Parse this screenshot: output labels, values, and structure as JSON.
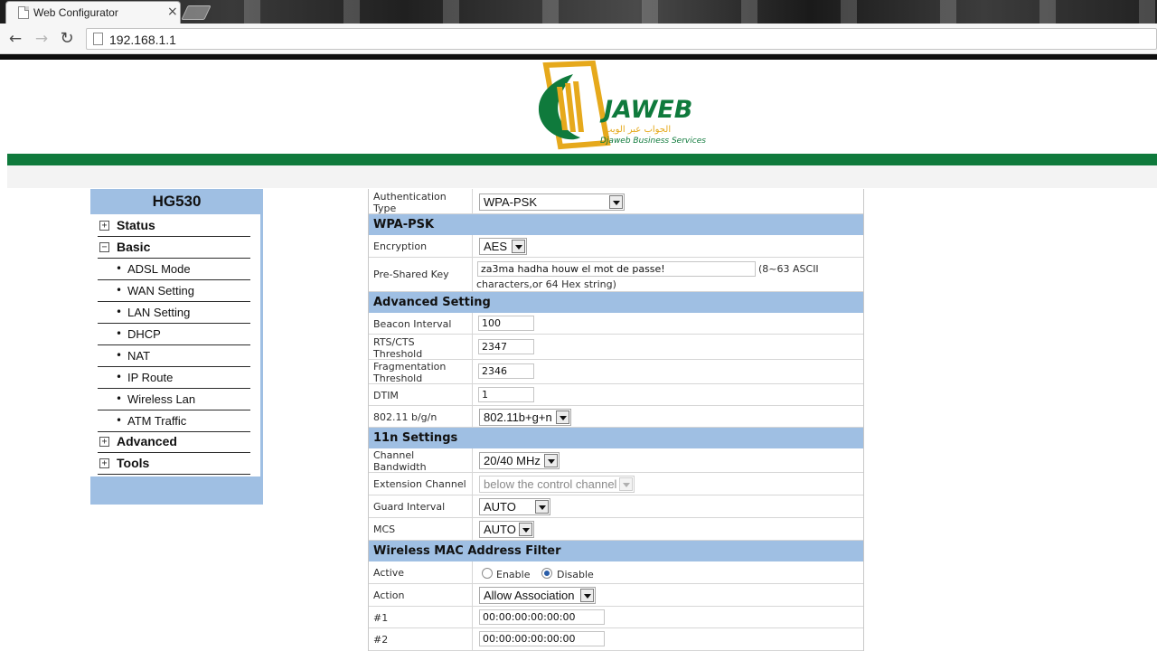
{
  "browser": {
    "tab_title": "Web Configurator",
    "tab_close": "×",
    "url": "192.168.1.1",
    "back_icon": "←",
    "forward_icon": "→",
    "reload_icon": "↻"
  },
  "brand": {
    "logo_text": "JAWEB",
    "logo_arabic": "الجواب عبر الويب",
    "logo_subtitle": "Djaweb Business Services",
    "colors": {
      "green": "#0f7a3c",
      "gold": "#e6a91c",
      "menu_blue": "#9fbfe3"
    }
  },
  "menu": {
    "title": "HG530",
    "items": [
      {
        "label": "Status",
        "toggle": "+"
      },
      {
        "label": "Basic",
        "toggle": "−"
      },
      {
        "label": "ADSL Mode"
      },
      {
        "label": "WAN Setting"
      },
      {
        "label": "LAN Setting"
      },
      {
        "label": "DHCP"
      },
      {
        "label": "NAT"
      },
      {
        "label": "IP Route"
      },
      {
        "label": "Wireless Lan"
      },
      {
        "label": "ATM Traffic"
      },
      {
        "label": "Advanced",
        "toggle": "+"
      },
      {
        "label": "Tools",
        "toggle": "+"
      }
    ]
  },
  "form": {
    "auth_type": {
      "label_1": "Authentication",
      "label_2": "Type",
      "value": "WPA-PSK"
    },
    "wpa_section": "WPA-PSK",
    "encryption": {
      "label": "Encryption",
      "value": "AES"
    },
    "psk": {
      "label": "Pre-Shared Key",
      "value": "za3ma hadha houw el mot de passe!",
      "hint_1": "(8~63 ASCII",
      "hint_2": "characters,or 64 Hex string)"
    },
    "advanced_section": "Advanced Setting",
    "beacon": {
      "label": "Beacon Interval",
      "value": "100"
    },
    "rts": {
      "label_1": "RTS/CTS",
      "label_2": "Threshold",
      "value": "2347"
    },
    "frag": {
      "label_1": "Fragmentation",
      "label_2": "Threshold",
      "value": "2346"
    },
    "dtim": {
      "label": "DTIM",
      "value": "1"
    },
    "mode": {
      "label": "802.11 b/g/n",
      "value": "802.11b+g+n"
    },
    "n_section": "11n Settings",
    "bandwidth": {
      "label_1": "Channel",
      "label_2": "Bandwidth",
      "value": "20/40 MHz"
    },
    "ext_channel": {
      "label": "Extension Channel",
      "value": "below the control channel"
    },
    "guard": {
      "label": "Guard Interval",
      "value": "AUTO"
    },
    "mcs": {
      "label": "MCS",
      "value": "AUTO"
    },
    "mac_section": "Wireless MAC Address Filter",
    "active": {
      "label": "Active",
      "enable": "Enable",
      "disable": "Disable",
      "selected": "Disable"
    },
    "action": {
      "label": "Action",
      "value": "Allow Association"
    },
    "mac1": {
      "label": "#1",
      "value": "00:00:00:00:00:00"
    },
    "mac2": {
      "label": "#2",
      "value": "00:00:00:00:00:00"
    }
  }
}
